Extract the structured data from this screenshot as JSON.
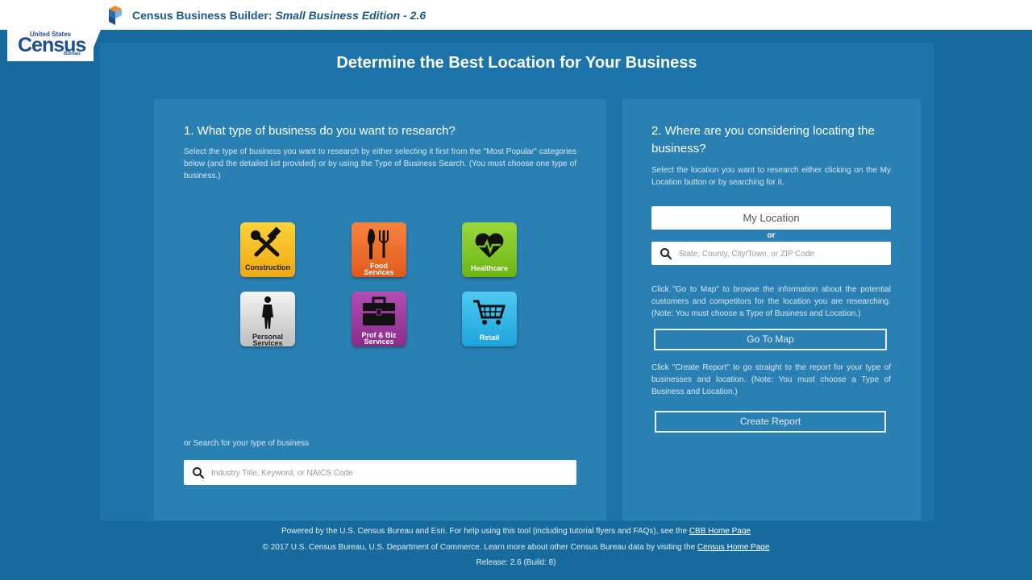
{
  "header": {
    "title_main": "Census Business Builder: ",
    "title_edition": "Small Business Edition - 2.6",
    "logo_icon": "cbb-logo-icon"
  },
  "census_logo": {
    "top": "United States",
    "main": "Census",
    "bottom": "Bureau"
  },
  "main": {
    "title": "Determine the Best Location for Your Business"
  },
  "left": {
    "heading": "1. What type of business do you want to research?",
    "description": "Select the type of business you want to research by either selecting it first from the \"Most Popular\" categories below (and the detailed list provided) or by using the Type of Business Search. (You must choose one type of business.)",
    "categories": [
      {
        "line1": "Construction",
        "line2": "",
        "icon": "tools-icon",
        "color": "#f2b61c"
      },
      {
        "line1": "Food",
        "line2": "Services",
        "icon": "fork-knife-icon",
        "color": "#ec6a26"
      },
      {
        "line1": "Healthcare",
        "line2": "",
        "icon": "heart-pulse-icon",
        "color": "#7fc51f"
      },
      {
        "line1": "Personal",
        "line2": "Services",
        "icon": "person-icon",
        "color": "#d4d4d4"
      },
      {
        "line1": "Prof & Biz",
        "line2": "Services",
        "icon": "briefcase-icon",
        "color": "#9b3a9b"
      },
      {
        "line1": "Retail",
        "line2": "",
        "icon": "cart-icon",
        "color": "#2bb2e6"
      }
    ],
    "search_label": "or Search for your type of business",
    "search_placeholder": "Industry Title, Keyword, or NAICS Code"
  },
  "right": {
    "heading_line1": "2. Where are you considering locating the",
    "heading_line2": "business?",
    "description": "Select the location you want to research either clicking on the My Location button or by searching for it.",
    "my_location_label": "My Location",
    "or_label": "or",
    "location_placeholder": "State, County, City/Town, or ZIP Code",
    "map_note": "Click \"Go to Map\" to browse the information about the potential customers and competitors for the location you are researching. (Note: You must choose a Type of Business and Location.)",
    "go_to_map_label": "Go To Map",
    "report_note": "Click \"Create Report\" to go straight to the report for your type of businesses and location. (Note: You must choose a Type of Business and Location.)",
    "create_report_label": "Create Report"
  },
  "footer": {
    "line1_text": "Powered by the U.S. Census Bureau and Esri. For help using this tool (including tutorial flyers and FAQs), see the ",
    "line1_link": "CBB Home Page",
    "line2_text": "© 2017 U.S. Census Bureau, U.S. Department of Commerce. Learn more about other Census Bureau data by visiting the ",
    "line2_link": "Census Home Page",
    "line3_text": "Release: 2.6 (Build: 8)"
  }
}
